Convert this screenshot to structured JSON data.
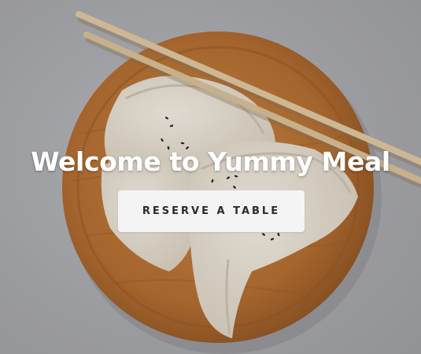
{
  "hero": {
    "title": "Welcome to Yummy Meal",
    "button_label": "RESERVE A TABLE",
    "image_description": "dumplings on a round wooden plate with chopsticks"
  },
  "colors": {
    "background": "#a9aaae",
    "plate": "#b8743a",
    "dumpling": "#ece4d7",
    "chopsticks": "#dcc4a0",
    "button_bg": "#f4f4f4",
    "button_text": "#2a2a2a",
    "title_text": "#ffffff"
  }
}
